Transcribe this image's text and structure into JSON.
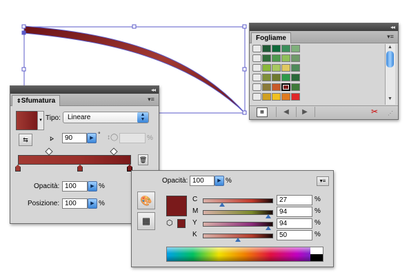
{
  "colors": {
    "path_stroke": "#5a59c8",
    "shape_fill_start": "#a23a33",
    "shape_fill_end": "#6b1216",
    "panel_bg": "#d6d6d6",
    "selected_swatch": "#7a1a1b"
  },
  "swatches_panel": {
    "tab_label": "Fogliame",
    "swatch_grid": [
      [
        "#1f5a35",
        "#0f6a3a",
        "#3b8f5a",
        "#7fb07c"
      ],
      [
        "#2f6d3a",
        "#4e9a4e",
        "#8fbf5a",
        "#6f9a6a"
      ],
      [
        "#8ab83a",
        "#a8c860",
        "#e0c860",
        "#4f8a5a"
      ],
      [
        "#7f8f3a",
        "#6f7a2f",
        "#2f9a4a",
        "#2a6a3a"
      ],
      [
        "#8a7a3a",
        "#c85a2a",
        "#7a1a1b",
        "#3f7a3a"
      ],
      [
        "#d0a020",
        "#f0c020",
        "#e07a20",
        "#e0282a"
      ]
    ],
    "footer_icons": [
      "swatch-kind-menu-icon",
      "prev-arrow-icon",
      "next-arrow-icon",
      "delete-swatch-icon"
    ]
  },
  "gradient_panel": {
    "tab_label": "Sfumatura",
    "type_label": "Tipo:",
    "type_value": "Lineare",
    "angle_value": "90",
    "angle_unit": "°",
    "aspect_unit": "%",
    "opacity_label": "Opacità:",
    "opacity_value": "100",
    "opacity_unit": "%",
    "position_label": "Posizione:",
    "position_value": "100",
    "position_unit": "%",
    "stop_colors": [
      "#a23a33",
      "#9a2f2a",
      "#7a1a1b"
    ]
  },
  "color_panel": {
    "opacity_label": "Opacità:",
    "opacity_value": "100",
    "opacity_unit": "%",
    "fill_color": "#7a1a1b",
    "channels": [
      {
        "label": "C",
        "value": "27",
        "unit": "%",
        "level": 0.27,
        "track": "#c0392b"
      },
      {
        "label": "M",
        "value": "94",
        "unit": "%",
        "level": 0.94,
        "track": "#7a8a2a"
      },
      {
        "label": "Y",
        "value": "94",
        "unit": "%",
        "level": 0.94,
        "track": "#8a2a7a"
      },
      {
        "label": "K",
        "value": "50",
        "unit": "%",
        "level": 0.5,
        "track": "#b23a2a"
      }
    ]
  }
}
